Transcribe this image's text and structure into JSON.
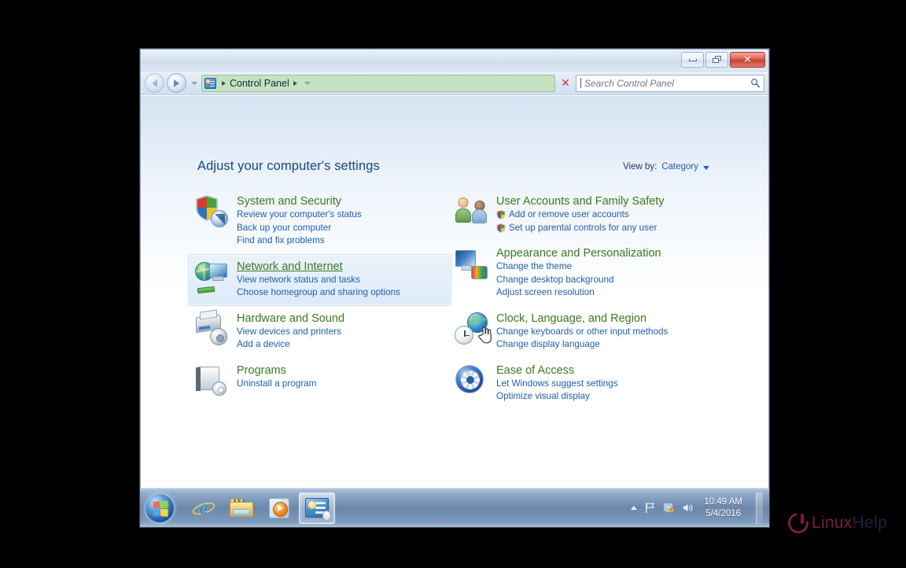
{
  "window": {
    "titlebar": {
      "minimize_label": "Minimize",
      "restore_label": "Restore",
      "close_label": "Close"
    },
    "address": {
      "back_label": "Back",
      "forward_label": "Forward",
      "history_label": "Recent pages",
      "icon": "control-panel-icon",
      "breadcrumb": "Control Panel",
      "refresh_label": "Stop",
      "dropdown_label": "Previous locations"
    },
    "search": {
      "placeholder": "Search Control Panel",
      "value": "",
      "icon": "search-icon"
    }
  },
  "page": {
    "title": "Adjust your computer's settings",
    "view_by_label": "View by:",
    "view_by_value": "Category"
  },
  "categories": {
    "left": [
      {
        "title": "System and Security",
        "icon": "shield-icon",
        "links": [
          {
            "text": "Review your computer's status"
          },
          {
            "text": "Back up your computer"
          },
          {
            "text": "Find and fix problems"
          }
        ]
      },
      {
        "title": "Network and Internet",
        "icon": "network-icon",
        "hovered": true,
        "links": [
          {
            "text": "View network status and tasks"
          },
          {
            "text": "Choose homegroup and sharing options"
          }
        ]
      },
      {
        "title": "Hardware and Sound",
        "icon": "printer-icon",
        "links": [
          {
            "text": "View devices and printers"
          },
          {
            "text": "Add a device"
          }
        ]
      },
      {
        "title": "Programs",
        "icon": "programs-icon",
        "links": [
          {
            "text": "Uninstall a program"
          }
        ]
      }
    ],
    "right": [
      {
        "title": "User Accounts and Family Safety",
        "icon": "users-icon",
        "links": [
          {
            "text": "Add or remove user accounts",
            "shield": true
          },
          {
            "text": "Set up parental controls for any user",
            "shield": true
          }
        ]
      },
      {
        "title": "Appearance and Personalization",
        "icon": "appearance-icon",
        "links": [
          {
            "text": "Change the theme"
          },
          {
            "text": "Change desktop background"
          },
          {
            "text": "Adjust screen resolution"
          }
        ]
      },
      {
        "title": "Clock, Language, and Region",
        "icon": "clock-globe-icon",
        "links": [
          {
            "text": "Change keyboards or other input methods"
          },
          {
            "text": "Change display language"
          }
        ]
      },
      {
        "title": "Ease of Access",
        "icon": "ease-of-access-icon",
        "links": [
          {
            "text": "Let Windows suggest settings"
          },
          {
            "text": "Optimize visual display"
          }
        ]
      }
    ]
  },
  "taskbar": {
    "start_label": "Start",
    "buttons": [
      {
        "name": "internet-explorer",
        "label": "Internet Explorer"
      },
      {
        "name": "windows-explorer",
        "label": "Windows Explorer"
      },
      {
        "name": "windows-media-player",
        "label": "Windows Media Player"
      },
      {
        "name": "control-panel",
        "label": "Control Panel",
        "active": true
      }
    ],
    "tray": {
      "show_hidden_label": "Show hidden icons",
      "action_center_label": "Action Center",
      "network_label": "Network",
      "volume_label": "Volume",
      "time": "10:49 AM",
      "date": "5/4/2016",
      "show_desktop_label": "Show desktop"
    }
  },
  "watermark": {
    "text_primary": "Linux",
    "text_secondary": "Help"
  },
  "colors": {
    "category_title": "#3c7a1e",
    "link": "#1f5fae",
    "page_title": "#14477d",
    "breadcrumb_bg": "#c5e3c0",
    "close_button": "#c93d31"
  }
}
